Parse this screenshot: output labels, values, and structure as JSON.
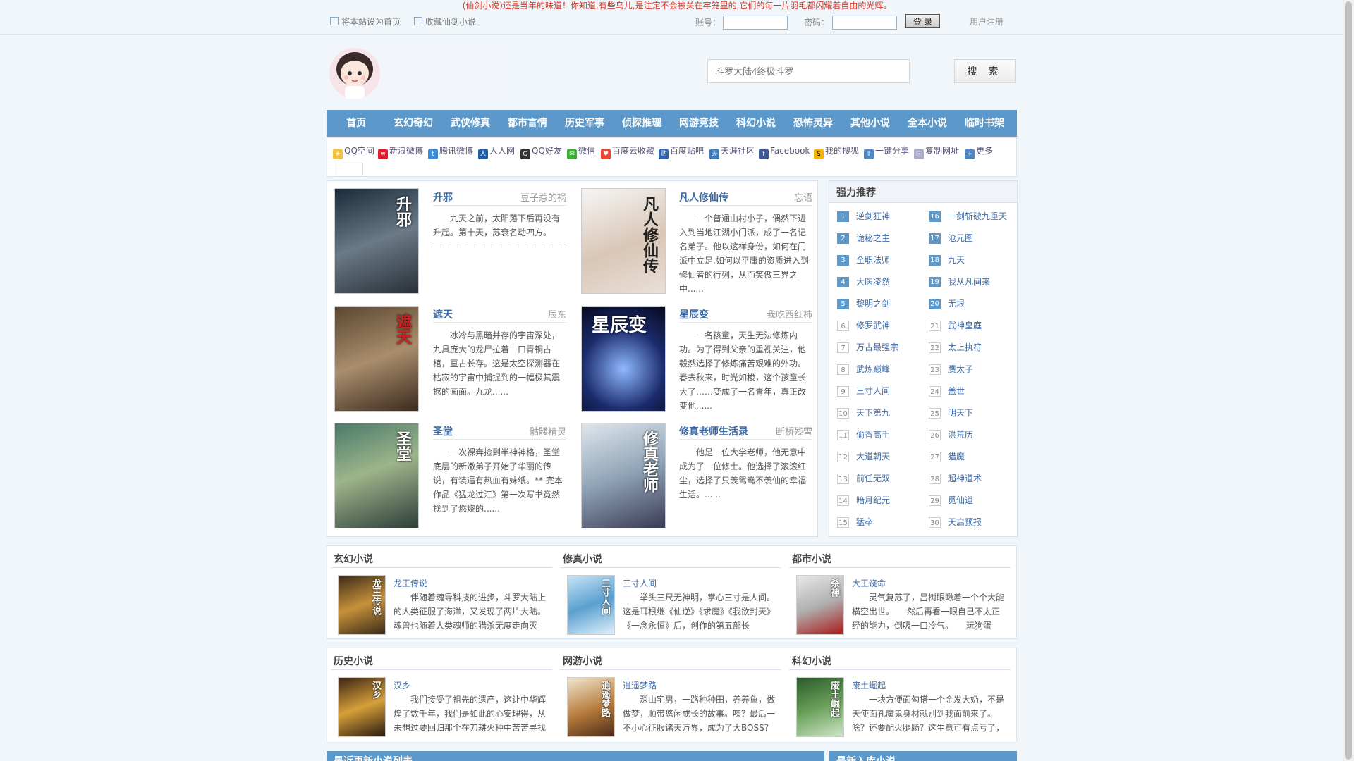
{
  "banner": "(仙剑小说)还是当年的味道！你知道,有些鸟儿,是注定不会被关在牢笼里的,它们的每一片羽毛都闪耀着自由的光辉。",
  "topbar": {
    "set_home": "将本站设为首页",
    "bookmark": "收藏仙剑小说",
    "account_label": "账号：",
    "password_label": "密码：",
    "login_button": "登 录",
    "register": "用户注册"
  },
  "search": {
    "placeholder": "斗罗大陆4终极斗罗",
    "button": "搜 索"
  },
  "nav": [
    "首页",
    "玄幻奇幻",
    "武侠修真",
    "都市言情",
    "历史军事",
    "侦探推理",
    "网游竞技",
    "科幻小说",
    "恐怖灵异",
    "其他小说",
    "全本小说",
    "临时书架"
  ],
  "share": [
    "QQ空间",
    "新浪微博",
    "腾讯微博",
    "人人网",
    "QQ好友",
    "微信",
    "百度云收藏",
    "百度贴吧",
    "天涯社区",
    "Facebook",
    "我的搜狐",
    "一键分享",
    "复制网址",
    "更多"
  ],
  "featured": [
    {
      "title": "升邪",
      "author": "豆子惹的祸",
      "cover": "升邪",
      "desc": "九天之前，太阳落下后再没有升起。第十天，苏衰名动四方。——————————————————————————————————————......"
    },
    {
      "title": "凡人修仙传",
      "author": "忘语",
      "cover": "凡人修仙传",
      "desc": "一个普通山村小子，偶然下进入到当地江湖小门派，成了一名记名弟子。他以这样身份，如何在门派中立足,如何以平庸的资质进入到修仙者的行列，从而笑傲三界之中......"
    },
    {
      "title": "遮天",
      "author": "辰东",
      "cover": "遮天",
      "desc": "冰冷与黑暗并存的宇宙深处，九具庞大的龙尸拉着一口青铜古棺，亘古长存。这是太空探测器在枯寂的宇宙中捕捉到的一幅极其震撼的画面。九龙......"
    },
    {
      "title": "星辰变",
      "author": "我吃西红柿",
      "cover": "星辰变",
      "desc": "一名孩童，天生无法修炼内功。为了得到父亲的重视关注，他毅然选择了修炼痛苦艰难的外功。春去秋来，时光如梭，这个孩童长大了……变成了一名青年，真正改变他......"
    },
    {
      "title": "圣堂",
      "author": "骷髅精灵",
      "cover": "圣堂",
      "desc": "一次裸奔捡到半神神格，圣堂底层的新嫩弟子开始了华丽的传说，有装逼有热血有妹纸。** 完本作品《猛龙过江》第一次写书竟然找到了燃烧的......"
    },
    {
      "title": "修真老师生活录",
      "author": "断桥残雪",
      "cover": "修真老师",
      "desc": "他是一位大学老师，他无意中成为了一位修士。他选择了滚滚红尘，选择了只羡鸳鸯不羡仙的幸福生活。......"
    }
  ],
  "recommend": {
    "title": "强力推荐",
    "left": [
      {
        "n": "1",
        "name": "逆剑狂神"
      },
      {
        "n": "2",
        "name": "诡秘之主"
      },
      {
        "n": "3",
        "name": "全职法师"
      },
      {
        "n": "4",
        "name": "大医凌然"
      },
      {
        "n": "5",
        "name": "黎明之剑"
      },
      {
        "n": "6",
        "name": "修罗武神"
      },
      {
        "n": "7",
        "name": "万古最强宗"
      },
      {
        "n": "8",
        "name": "武炼巅峰"
      },
      {
        "n": "9",
        "name": "三寸人间"
      },
      {
        "n": "10",
        "name": "天下第九"
      },
      {
        "n": "11",
        "name": "偷香高手"
      },
      {
        "n": "12",
        "name": "大道朝天"
      },
      {
        "n": "13",
        "name": "前任无双"
      },
      {
        "n": "14",
        "name": "暗月纪元"
      },
      {
        "n": "15",
        "name": "猛卒"
      }
    ],
    "right": [
      {
        "n": "16",
        "name": "一剑斩破九重天"
      },
      {
        "n": "17",
        "name": "沧元图"
      },
      {
        "n": "18",
        "name": "九天"
      },
      {
        "n": "19",
        "name": "我从凡间来"
      },
      {
        "n": "20",
        "name": "无垠"
      },
      {
        "n": "21",
        "name": "武神皇庭"
      },
      {
        "n": "22",
        "name": "太上执符"
      },
      {
        "n": "23",
        "name": "赝太子"
      },
      {
        "n": "24",
        "name": "盖世"
      },
      {
        "n": "25",
        "name": "明天下"
      },
      {
        "n": "26",
        "name": "洪荒历"
      },
      {
        "n": "27",
        "name": "猎魔"
      },
      {
        "n": "28",
        "name": "超神道术"
      },
      {
        "n": "29",
        "name": "觅仙道"
      },
      {
        "n": "30",
        "name": "天启预报"
      }
    ]
  },
  "categories": [
    {
      "title": "玄幻小说",
      "book": "龙王传说",
      "cover": "龙王传说",
      "desc": "伴随着魂导科技的进步，斗罗大陆上的人类征服了海洋，又发现了两片大陆。魂兽也随着人类魂师的猎杀无度走向灭"
    },
    {
      "title": "修真小说",
      "book": "三寸人间",
      "cover": "三寸人间",
      "desc": "举头三尺无神明，掌心三寸是人间。这是耳根继《仙逆》《求魔》《我欲封天》《一念永恒》后，创作的第五部长"
    },
    {
      "title": "都市小说",
      "book": "大王饶命",
      "cover": "杀神",
      "desc": "灵气复苏了，吕树眼瞅着一个个大能横空出世。　　然后再看一眼自己不太正经的能力，倒吸一口冷气。　　玩狗蛋"
    },
    {
      "title": "历史小说",
      "book": "汉乡",
      "cover": "汉乡",
      "desc": "我们接受了祖先的遗产，这让中华辉煌了数千年，我们是如此的心安理得，从未想过要回归那个在刀耕火种中苦苦寻找"
    },
    {
      "title": "网游小说",
      "book": "逍遥梦路",
      "cover": "逍遥梦路",
      "desc": "深山宅男，一路种种田，养养鱼，做做梦，顺带悠闲成长的故事。咦？最后一不小心征服诸天万界，成为了大BOSS？莫"
    },
    {
      "title": "科幻小说",
      "book": "废土崛起",
      "cover": "废土崛起",
      "desc": "一块方便面勾搭一个金发大奶，不是天使面孔魔鬼身材就别到我面前来了。啥？还要配火腿肠？这生意可有点亏了，"
    }
  ],
  "bottom_bars": [
    "最近更新小说列表",
    "最新入库小说"
  ]
}
